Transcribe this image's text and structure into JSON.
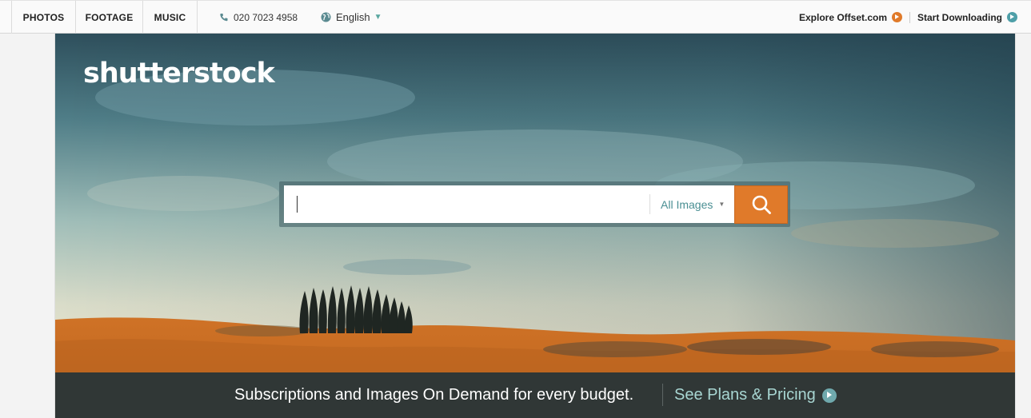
{
  "nav": {
    "tabs": [
      {
        "label": "PHOTOS"
      },
      {
        "label": "FOOTAGE"
      },
      {
        "label": "MUSIC"
      }
    ],
    "phone": "020 7023 4958",
    "language": "English",
    "offset_link": "Explore Offset.com",
    "download_link": "Start Downloading"
  },
  "hero": {
    "logo": "shutterstock"
  },
  "search": {
    "value": "",
    "filter_label": "All Images"
  },
  "promo": {
    "text": "Subscriptions and Images On Demand for every budget.",
    "link": "See Plans & Pricing"
  },
  "colors": {
    "accent": "#e07a2a",
    "teal": "#4e9fa8",
    "promo_bg": "#303736"
  }
}
